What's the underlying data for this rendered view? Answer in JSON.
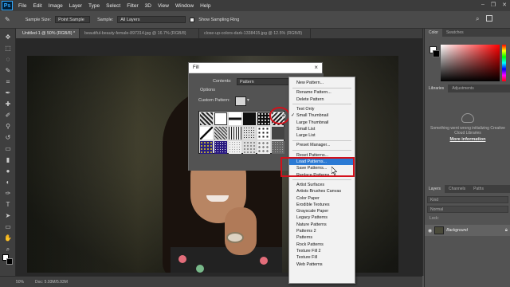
{
  "menubar": {
    "logo": "Ps",
    "items": [
      "File",
      "Edit",
      "Image",
      "Layer",
      "Type",
      "Select",
      "Filter",
      "3D",
      "View",
      "Window",
      "Help"
    ],
    "window_controls": [
      "–",
      "❐",
      "✕"
    ]
  },
  "options_bar": {
    "sample_size_label": "Sample Size:",
    "sample_size_value": "Point Sample",
    "sample_label": "Sample:",
    "sample_value": "All Layers",
    "show_ring_label": "Show Sampling Ring"
  },
  "doc_tabs": [
    "Untitled-1 @ 50% (RGB/8) *",
    "beautiful-beauty-female-897314.jpg @ 16.7% (RGB/8)",
    "close-up-colors-dark-1338415.jpg @ 12.5% (RGB/8)"
  ],
  "status_bar": {
    "zoom": "50%",
    "doc_info": "Doc: 5.93M/5.93M"
  },
  "right_panel": {
    "color_tabs": [
      "Color",
      "Swatches"
    ],
    "libraries_tabs": [
      "Libraries",
      "Adjustments"
    ],
    "libraries_message": "Something went wrong initializing Creative Cloud Libraries",
    "more_info": "More information",
    "layers_tabs": [
      "Layers",
      "Channels",
      "Paths"
    ],
    "layer_kind": "Kind",
    "blend_mode": "Normal",
    "lock_label": "Lock:",
    "background_layer": "Background"
  },
  "fill_dialog": {
    "title": "Fill",
    "contents_label": "Contents:",
    "contents_value": "Pattern",
    "options_label": "Options",
    "custom_pattern_label": "Custom Pattern:"
  },
  "context_menu": {
    "groups": [
      [
        "New Pattern..."
      ],
      [
        "Rename Pattern...",
        "Delete Pattern"
      ],
      [
        "Text Only",
        "Small Thumbnail",
        "Large Thumbnail",
        "Small List",
        "Large List"
      ],
      [
        "Preset Manager..."
      ],
      [
        "Reset Patterns...",
        "Load Patterns...",
        "Save Patterns...",
        "Replace Patterns..."
      ],
      [
        "Artist Surfaces",
        "Artists Brushes Canvas",
        "Color Paper",
        "Erodible Textures",
        "Grayscale Paper",
        "Legacy Patterns",
        "Nature Patterns",
        "Patterns 2",
        "Patterns",
        "Rock Patterns",
        "Texture Fill 2",
        "Texture Fill",
        "Web Patterns"
      ]
    ],
    "checked_item": "Small Thumbnail",
    "highlighted_item": "Load Patterns..."
  },
  "colors": {
    "highlight": "#2b7ad4",
    "annotation_red": "#d4111b"
  }
}
